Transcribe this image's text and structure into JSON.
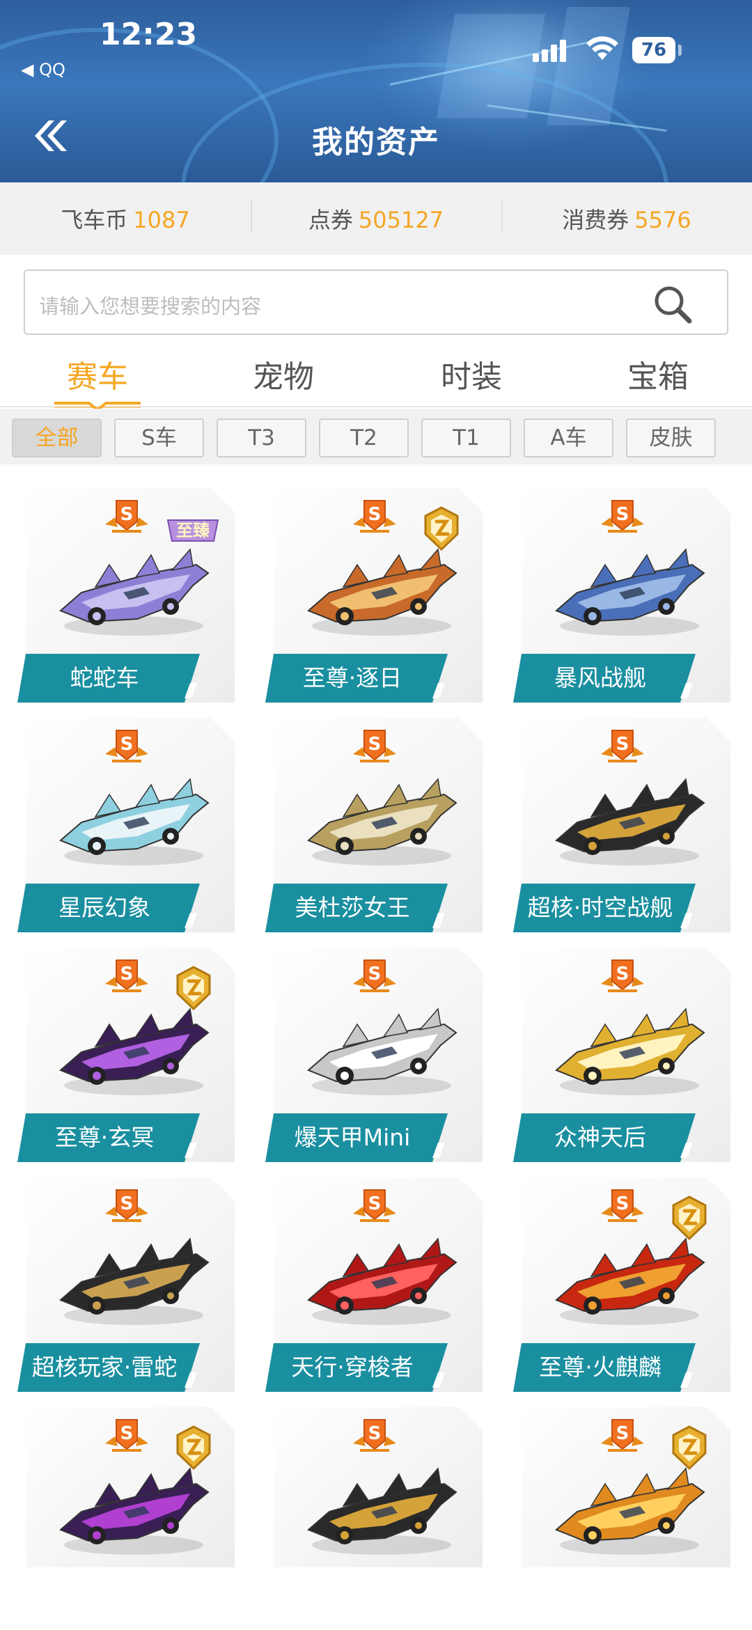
{
  "status_bar": {
    "time": "12:23",
    "back_app": "◀ QQ",
    "battery": "76"
  },
  "header": {
    "title": "我的资产"
  },
  "balances": [
    {
      "label": "飞车币",
      "value": "1087"
    },
    {
      "label": "点券",
      "value": "505127"
    },
    {
      "label": "消费券",
      "value": "5576"
    }
  ],
  "search": {
    "placeholder": "请输入您想要搜索的内容"
  },
  "tabs": [
    "赛车",
    "宠物",
    "时装",
    "宝箱"
  ],
  "active_tab": "赛车",
  "filters": [
    "全部",
    "S车",
    "T3",
    "T2",
    "T1",
    "A车",
    "皮肤"
  ],
  "active_filter": "全部",
  "colors": {
    "accent": "#f5a623",
    "label_teal": "#1a8fa0",
    "header_blue": "#2d5e9c"
  },
  "cars": [
    {
      "name": "蛇蛇车",
      "grade": "S",
      "tag": "至臻",
      "colors": [
        "#8e7fd6",
        "#c8c0f0"
      ]
    },
    {
      "name": "至尊·逐日",
      "grade": "S",
      "gold_badge": true,
      "colors": [
        "#c86a2a",
        "#f0c070"
      ]
    },
    {
      "name": "暴风战舰",
      "grade": "S",
      "colors": [
        "#4a6fb8",
        "#9ab8e6"
      ]
    },
    {
      "name": "星辰幻象",
      "grade": "S",
      "colors": [
        "#8fd0e0",
        "#e8f4f8"
      ]
    },
    {
      "name": "美杜莎女王",
      "grade": "S",
      "colors": [
        "#b8a060",
        "#eae0c0"
      ]
    },
    {
      "name": "超核·时空战舰",
      "grade": "S",
      "colors": [
        "#2a2a2a",
        "#d4a23a"
      ]
    },
    {
      "name": "至尊·玄冥",
      "grade": "S",
      "gold_badge": true,
      "colors": [
        "#3a1f55",
        "#b060e0"
      ]
    },
    {
      "name": "爆天甲Mini",
      "grade": "S",
      "colors": [
        "#c8c8c8",
        "#ffffff"
      ]
    },
    {
      "name": "众神天后",
      "grade": "S",
      "colors": [
        "#e0b030",
        "#fff3c0"
      ]
    },
    {
      "name": "超核玩家·雷蛇",
      "grade": "S",
      "colors": [
        "#2a2a2a",
        "#c8a050"
      ]
    },
    {
      "name": "天行·穿梭者",
      "grade": "S",
      "colors": [
        "#b01818",
        "#ff6060"
      ]
    },
    {
      "name": "至尊·火麒麟",
      "grade": "S",
      "gold_badge": true,
      "colors": [
        "#c82810",
        "#f0a030"
      ]
    },
    {
      "name": "",
      "grade": "S",
      "gold_badge": true,
      "colors": [
        "#3a1f55",
        "#b040d0"
      ]
    },
    {
      "name": "",
      "grade": "S",
      "colors": [
        "#2a2a2a",
        "#d4a23a"
      ]
    },
    {
      "name": "",
      "grade": "S",
      "gold_badge": true,
      "colors": [
        "#e08a20",
        "#ffd060"
      ]
    }
  ]
}
